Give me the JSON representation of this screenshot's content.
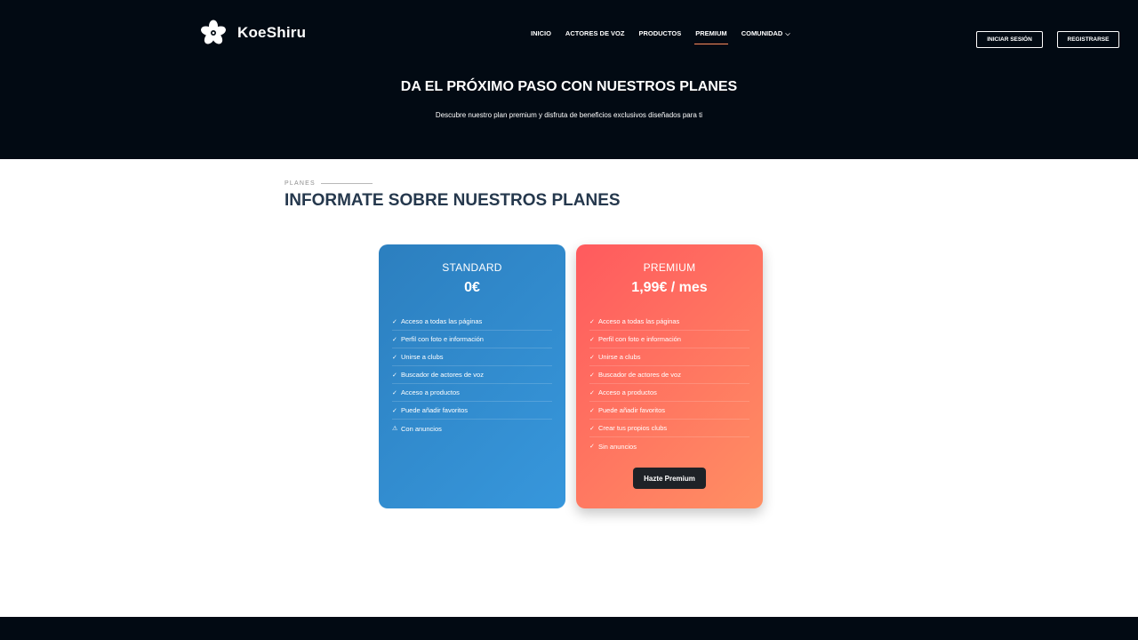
{
  "brand": {
    "name": "KoeShiru",
    "logo_icon": "sakura-flower-icon"
  },
  "nav": {
    "items": [
      {
        "label": "INICIO",
        "active": false
      },
      {
        "label": "ACTORES DE VOZ",
        "active": false
      },
      {
        "label": "PRODUCTOS",
        "active": false
      },
      {
        "label": "PREMIUM",
        "active": true
      },
      {
        "label": "COMUNIDAD",
        "active": false,
        "icon": "chevron-down-icon"
      }
    ],
    "active_underline_color": "#ff8a5b"
  },
  "auth": {
    "login_label": "INICIAR SESIÓN",
    "register_label": "REGISTRARSE"
  },
  "hero": {
    "title": "DA EL PRÓXIMO PASO CON NUESTROS PLANES",
    "subtitle": "Descubre nuestro plan premium y disfruta de beneficios exclusivos diseñados para ti"
  },
  "section": {
    "eyebrow": "PLANES",
    "title": "INFORMATE SOBRE NUESTROS PLANES"
  },
  "plans": {
    "standard": {
      "name": "STANDARD",
      "price": "0€",
      "features": [
        {
          "mark": "✓",
          "text": "Acceso a todas las páginas"
        },
        {
          "mark": "✓",
          "text": "Perfil con foto e información"
        },
        {
          "mark": "✓",
          "text": "Unirse a clubs"
        },
        {
          "mark": "✓",
          "text": "Buscador de actores de voz"
        },
        {
          "mark": "✓",
          "text": "Acceso a productos"
        },
        {
          "mark": "✓",
          "text": "Puede añadir favoritos"
        },
        {
          "mark": "⚠",
          "text": "Con anuncios"
        }
      ]
    },
    "premium": {
      "name": "PREMIUM",
      "price": "1,99€ / mes",
      "features": [
        {
          "mark": "✓",
          "text": "Acceso a todas las páginas"
        },
        {
          "mark": "✓",
          "text": "Perfil con foto e información"
        },
        {
          "mark": "✓",
          "text": "Unirse a clubs"
        },
        {
          "mark": "✓",
          "text": "Buscador de actores de voz"
        },
        {
          "mark": "✓",
          "text": "Acceso a productos"
        },
        {
          "mark": "✓",
          "text": "Puede añadir favoritos"
        },
        {
          "mark": "✓",
          "text": "Crear tus propios clubs"
        },
        {
          "mark": "✓",
          "text": "Sin anuncios"
        }
      ],
      "cta_label": "Hazte Premium"
    }
  },
  "colors": {
    "header_bg": "#020a13",
    "standard_gradient": [
      "#2c7fbf",
      "#3797dc"
    ],
    "premium_gradient": [
      "#ff5a5e",
      "#ff8f63"
    ],
    "section_title": "#25384d"
  }
}
